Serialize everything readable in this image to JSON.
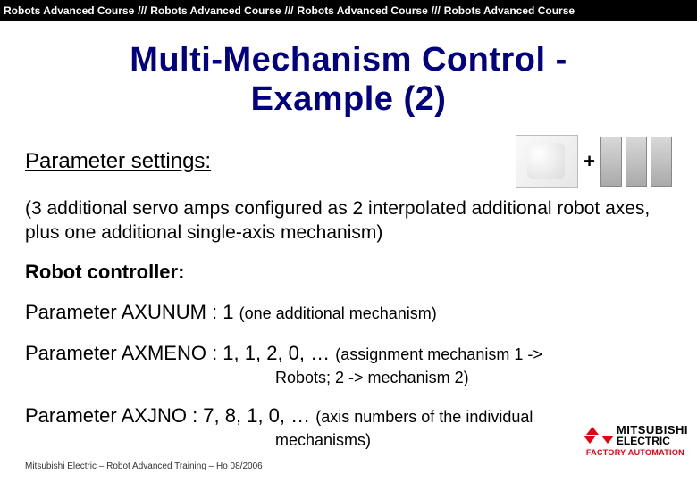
{
  "header": {
    "segment": "Robots Advanced Course",
    "sep": "///"
  },
  "title_line1": "Multi-Mechanism Control -",
  "title_line2": "Example (2)",
  "section_heading": "Parameter settings:",
  "plus_symbol": "+",
  "description": "(3 additional servo amps configured as 2 interpolated additional robot axes, plus one additional single-axis mechanism)",
  "controller_heading": "Robot controller:",
  "params": {
    "axunum": {
      "label": "Parameter AXUNUM : 1 ",
      "note": "(one additional mechanism)"
    },
    "axmeno": {
      "label": "Parameter AXMENO : 1, 1, 2, 0, … ",
      "note1": "(assignment mechanism 1 ->",
      "note2": "Robots; 2 -> mechanism 2)"
    },
    "axjno": {
      "label": "Parameter AXJNO : 7, 8, 1, 0, … ",
      "note1": "(axis numbers of the individual",
      "note2": "mechanisms)"
    }
  },
  "footer_credit": "Mitsubishi Electric – Robot Advanced Training – Ho 08/2006",
  "logo": {
    "brand": "MITSUBISHI",
    "company": "ELECTRIC",
    "subline": "FACTORY AUTOMATION"
  }
}
